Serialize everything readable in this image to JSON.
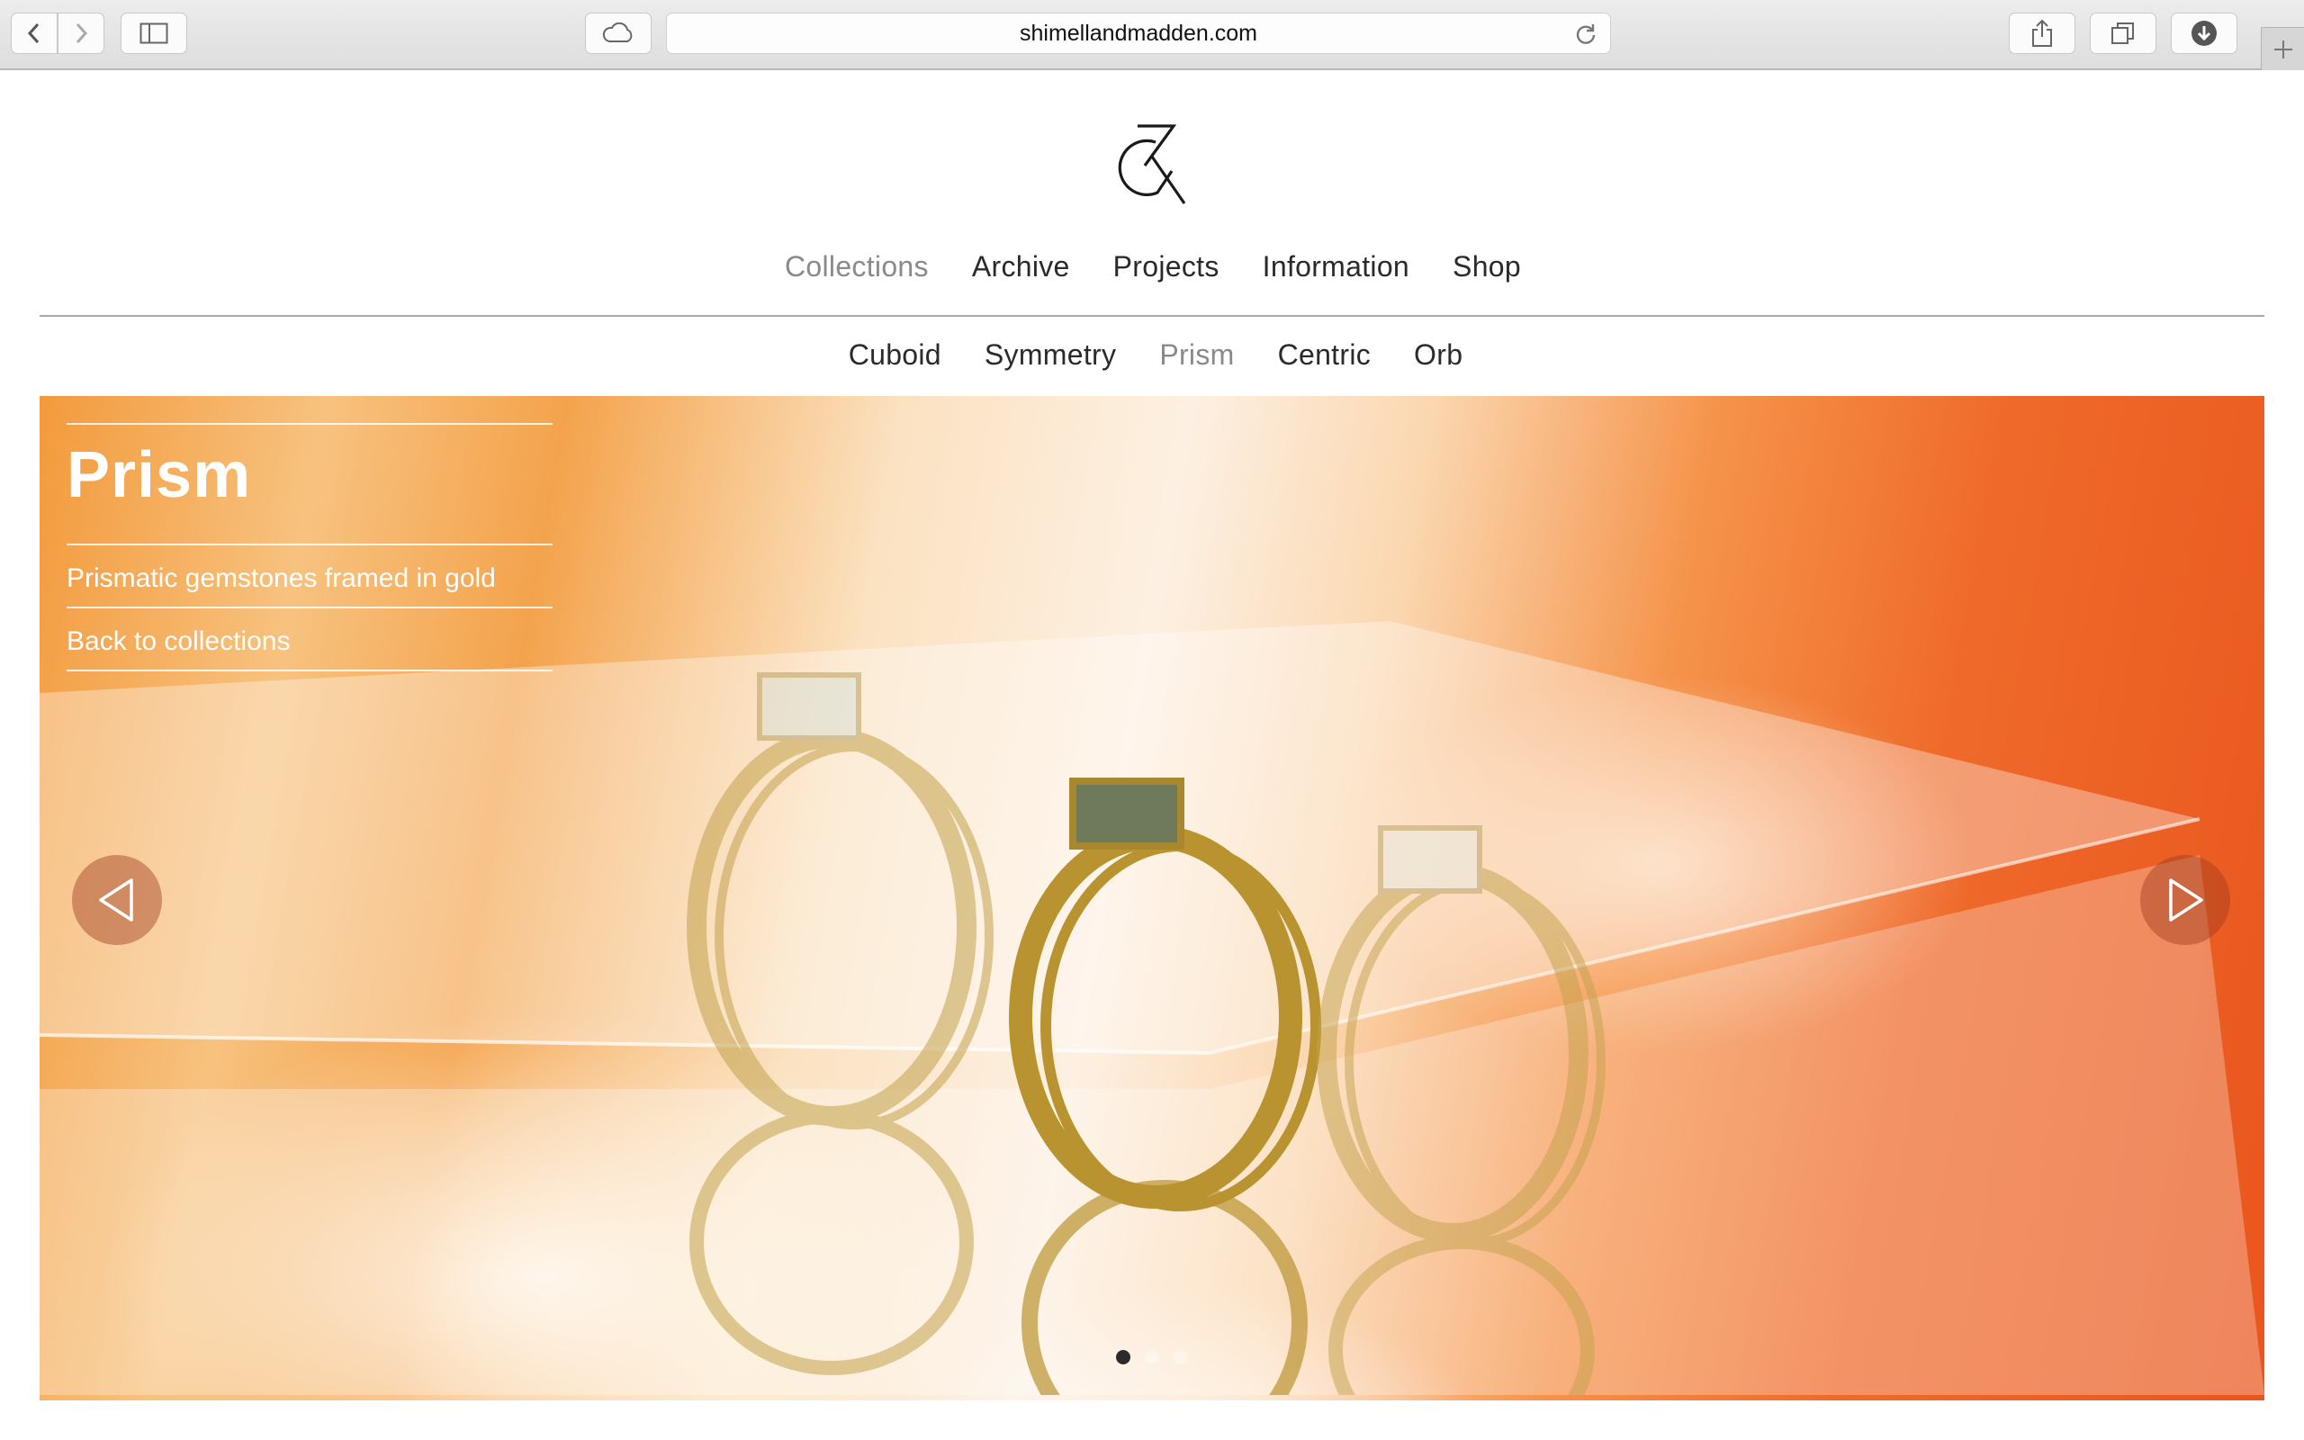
{
  "browser": {
    "url": "shimellandmadden.com"
  },
  "nav": {
    "items": [
      {
        "label": "Collections",
        "active": true
      },
      {
        "label": "Archive",
        "active": false
      },
      {
        "label": "Projects",
        "active": false
      },
      {
        "label": "Information",
        "active": false
      },
      {
        "label": "Shop",
        "active": false
      }
    ]
  },
  "subnav": {
    "items": [
      {
        "label": "Cuboid",
        "active": false
      },
      {
        "label": "Symmetry",
        "active": false
      },
      {
        "label": "Prism",
        "active": true
      },
      {
        "label": "Centric",
        "active": false
      },
      {
        "label": "Orb",
        "active": false
      }
    ]
  },
  "hero": {
    "title": "Prism",
    "tagline": "Prismatic gemstones framed in gold",
    "back_link": "Back to collections",
    "slide_count": 3,
    "current_slide": 1
  },
  "colors": {
    "accent_orange": "#ef6a2a",
    "gold": "#c9a43a",
    "text": "#2a2a2a",
    "muted": "#8a8a8a"
  }
}
